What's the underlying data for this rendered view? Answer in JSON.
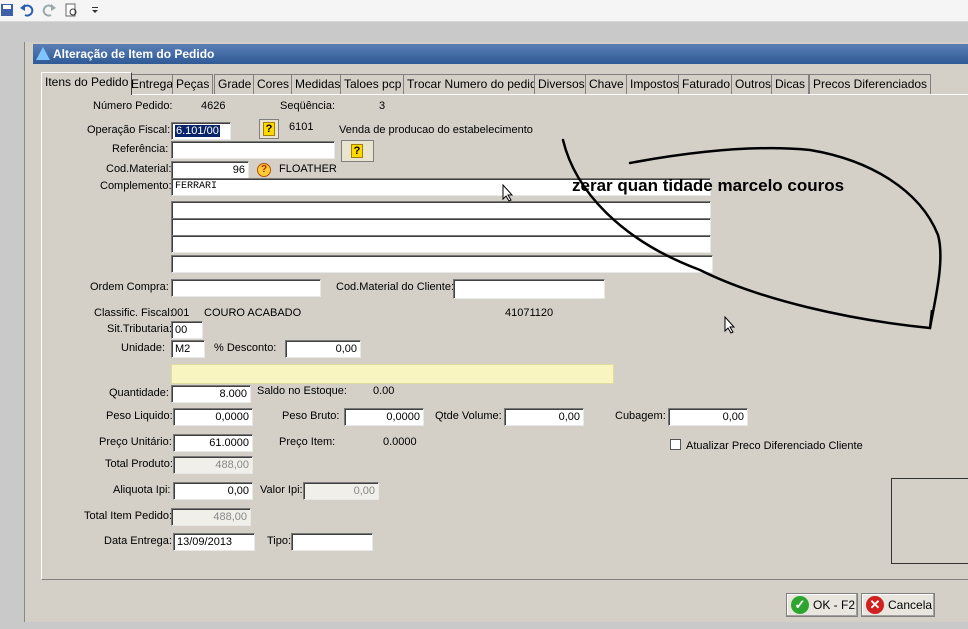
{
  "window": {
    "title": "Alteração de Item do Pedido"
  },
  "tabs": [
    "Itens do Pedido",
    "Entrega",
    "Peças",
    "Grade",
    "Cores",
    "Medidas",
    "Taloes pcp",
    "Trocar Numero do pedido",
    "Diversos",
    "Chave",
    "Impostos",
    "Faturado",
    "Outros",
    "Dicas",
    "Precos Diferenciados"
  ],
  "form": {
    "numero_pedido_label": "Número Pedido:",
    "numero_pedido": "4626",
    "sequencia_label": "Seqüência:",
    "sequencia": "3",
    "operacao_fiscal_label": "Operação Fiscal:",
    "operacao_fiscal": "6.101/00",
    "operacao_codigo": "6101",
    "operacao_descricao": "Venda de producao do estabelecimento",
    "referencia_label": "Referência:",
    "referencia": "",
    "cod_material_label": "Cod.Material:",
    "cod_material": "96",
    "material_nome": "FLOATHER",
    "complemento_label": "Complemento:",
    "complemento_lines": [
      "FERRARI",
      "",
      "",
      "",
      ""
    ],
    "ordem_compra_label": "Ordem Compra:",
    "ordem_compra": "",
    "cod_material_cliente_label": "Cod.Material do Cliente:",
    "cod_material_cliente": "",
    "classific_fiscal_label": "Classific. Fiscal:",
    "classific_fiscal_codigo": "001",
    "classific_fiscal_descricao": "COURO ACABADO",
    "ncm": "41071120",
    "sit_tributaria_label": "Sit.Tributaria:",
    "sit_tributaria": "00",
    "unidade_label": "Unidade:",
    "unidade": "M2",
    "desconto_label": "% Desconto:",
    "desconto": "0,00",
    "quantidade_label": "Quantidade:",
    "quantidade": "8.000",
    "saldo_estoque_label": "Saldo no Estoque:",
    "saldo_estoque": "0.00",
    "peso_liquido_label": "Peso Liquido:",
    "peso_liquido": "0,0000",
    "peso_bruto_label": "Peso Bruto:",
    "peso_bruto": "0,0000",
    "qtde_volume_label": "Qtde Volume:",
    "qtde_volume": "0,00",
    "cubagem_label": "Cubagem:",
    "cubagem": "0,00",
    "preco_unitario_label": "Preço Unitário:",
    "preco_unitario": "61.0000",
    "preco_item_label": "Preço Item:",
    "preco_item": "0.0000",
    "atualizar_preco_label": "Atualizar Preco Diferenciado Cliente",
    "total_produto_label": "Total Produto:",
    "total_produto": "488,00",
    "aliquota_ipi_label": "Aliquota Ipi:",
    "aliquota_ipi": "0,00",
    "valor_ipi_label": "Valor Ipi:",
    "valor_ipi": "0,00",
    "total_item_pedido_label": "Total Item Pedido:",
    "total_item_pedido": "488,00",
    "data_entrega_label": "Data Entrega:",
    "data_entrega": "13/09/2013",
    "tipo_label": "Tipo:",
    "tipo": ""
  },
  "buttons": {
    "ok": "OK - F2",
    "cancel": "Cancela"
  },
  "annotation": "zerar quan tidade marcelo couros"
}
